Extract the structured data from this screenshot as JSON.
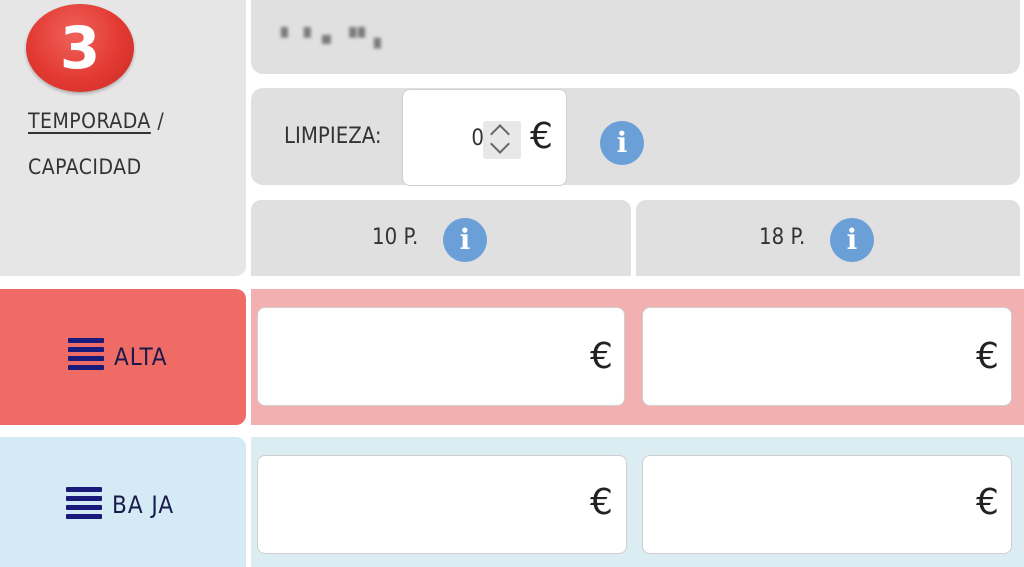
{
  "step": {
    "number": "3"
  },
  "left_header": {
    "title_line1": "TEMPORADA",
    "slash": " /",
    "title_line2": "CAPACIDAD"
  },
  "top_bar": {
    "blurred_text": "▘▝ ▪ ▝▘▖"
  },
  "cleaning": {
    "label": "LIMPIEZA:",
    "value": "0",
    "currency": "€"
  },
  "capacities": [
    {
      "label": "10 P."
    },
    {
      "label": "18 P."
    }
  ],
  "seasons": [
    {
      "label": "ALTA",
      "currency": "€",
      "color": "#ee6b66",
      "row_color": "#f2b0b0"
    },
    {
      "label": "BA JA",
      "currency": "€",
      "color": "#d4ebf5",
      "row_color": "#dcecf3"
    }
  ],
  "icons": {
    "info": "i",
    "menu": "hamburger-icon"
  },
  "colors": {
    "badge": "#e23a33",
    "info": "#6a9fd8"
  }
}
